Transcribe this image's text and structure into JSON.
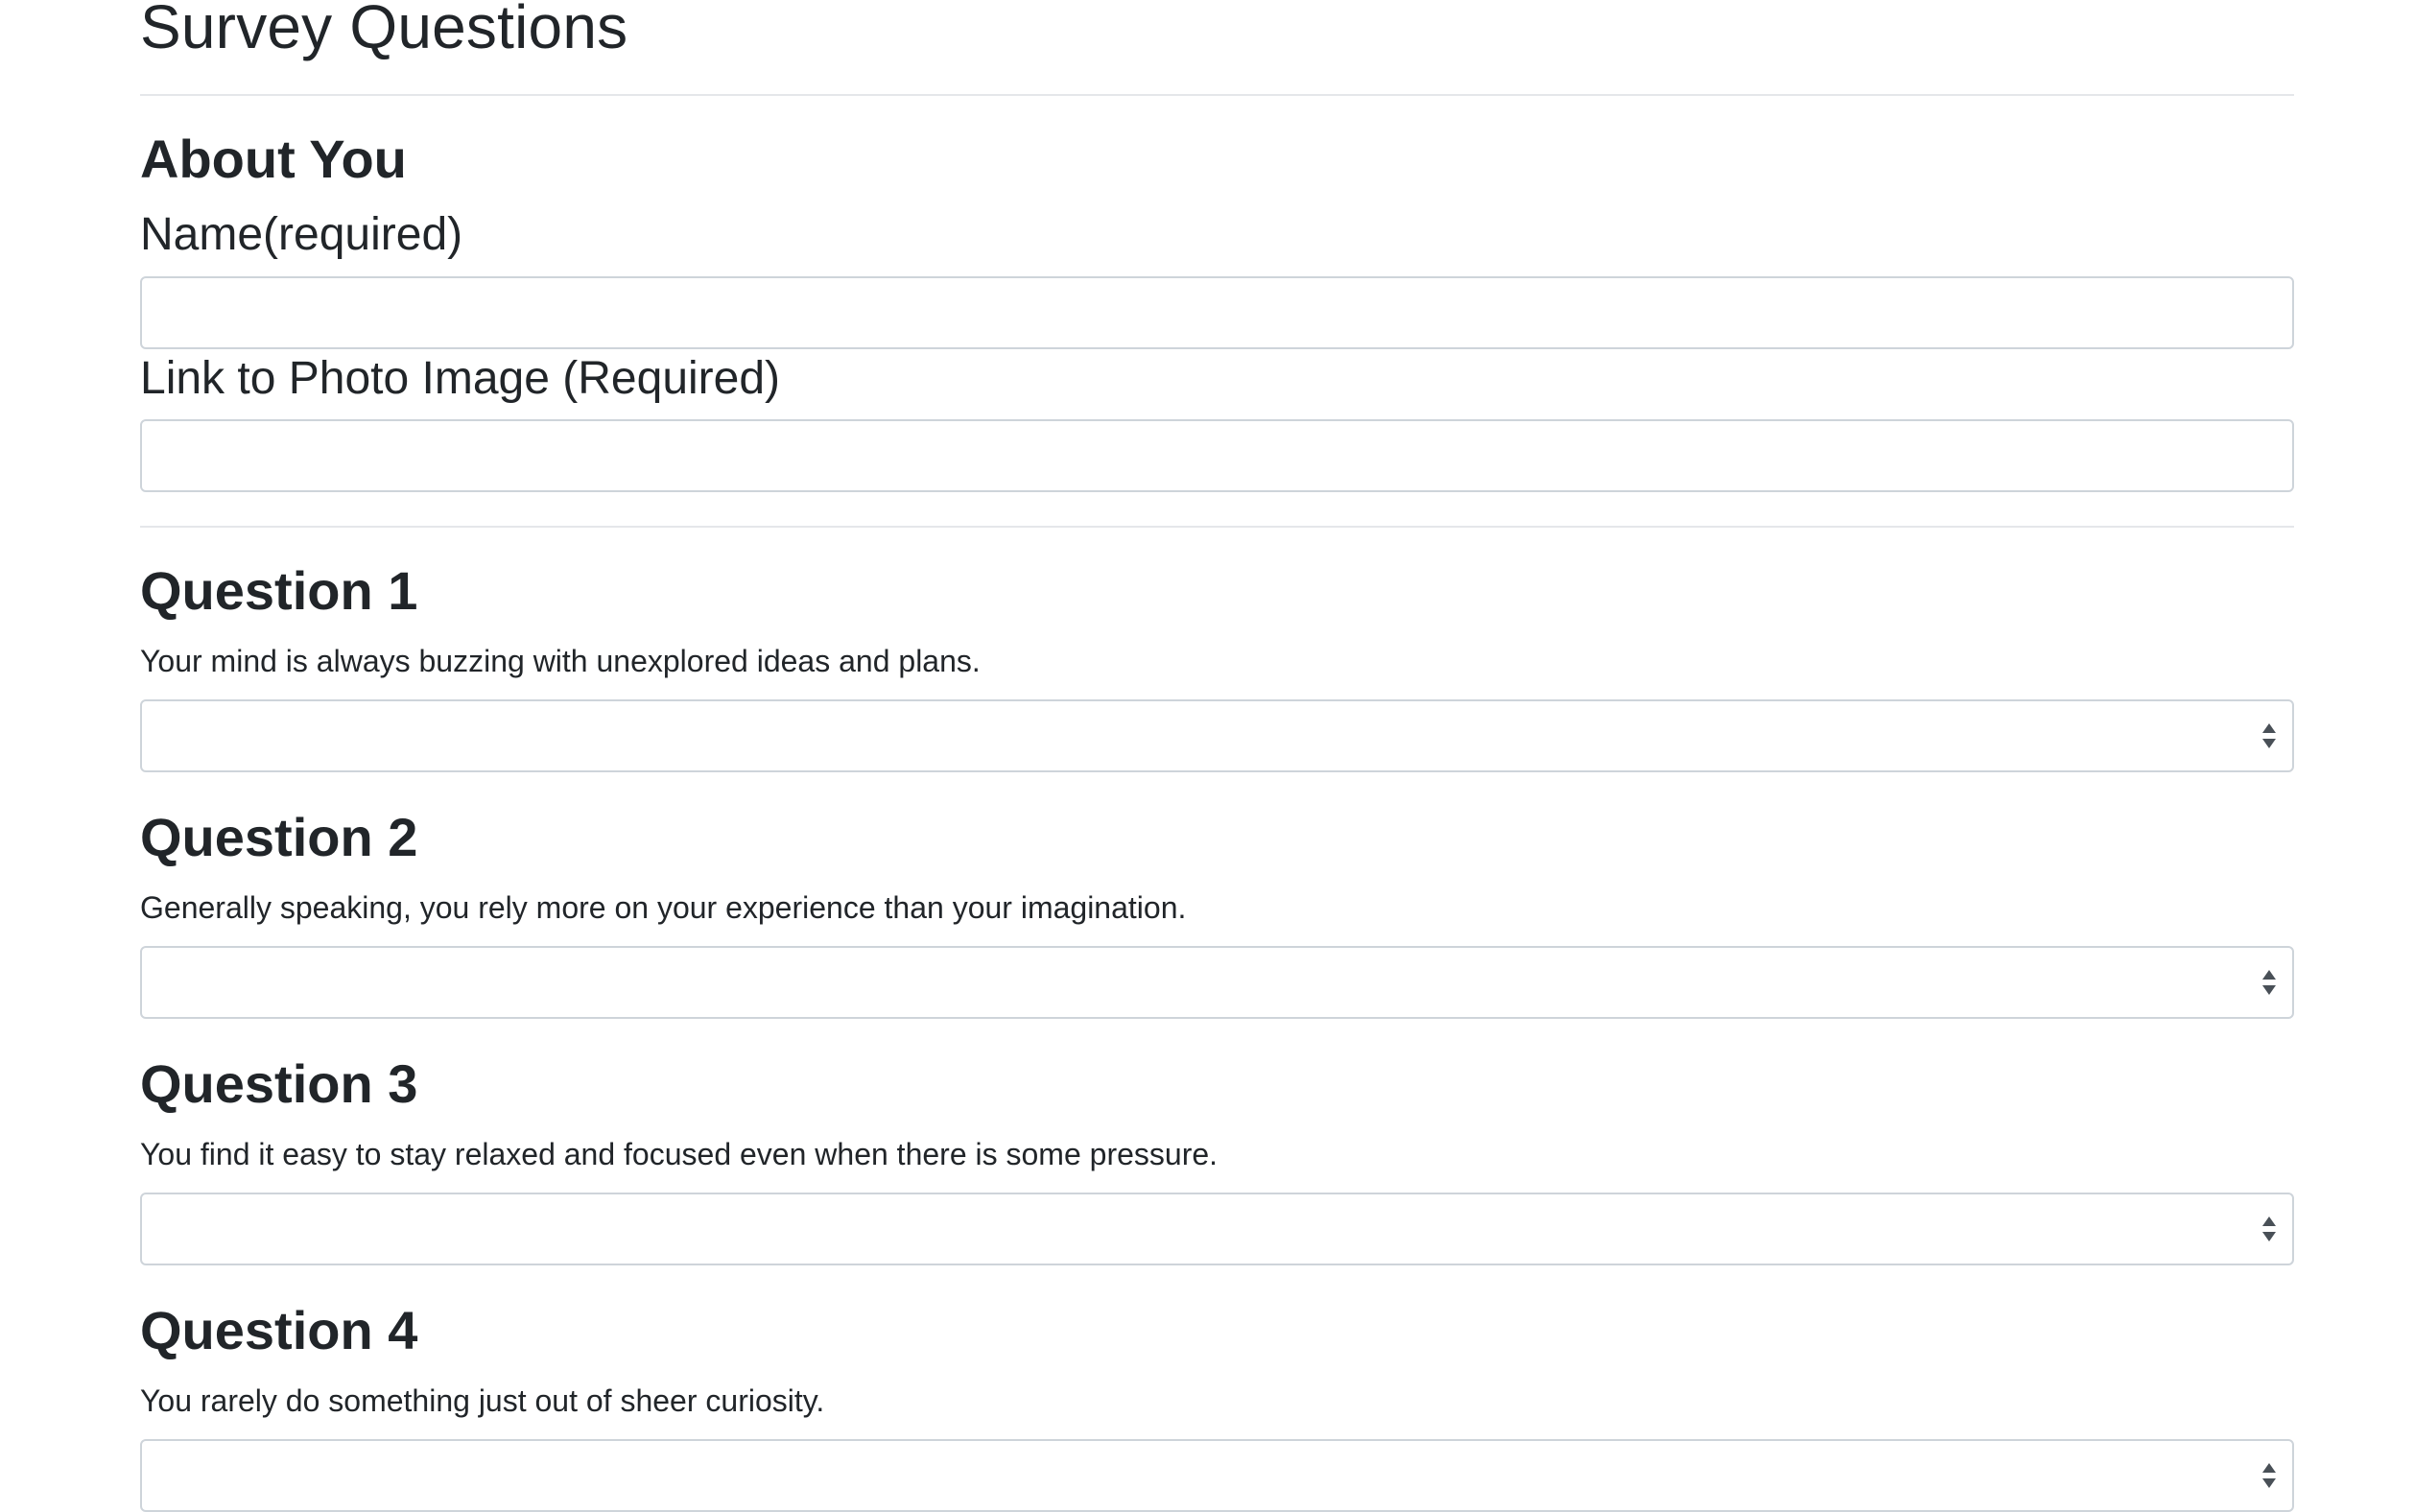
{
  "page": {
    "title": "Survey Questions"
  },
  "about": {
    "heading": "About You",
    "name_label": "Name(required)",
    "name_value": "",
    "photo_label": "Link to Photo Image (Required)",
    "photo_value": ""
  },
  "questions": [
    {
      "heading": "Question 1",
      "text": "Your mind is always buzzing with unexplored ideas and plans.",
      "selected": ""
    },
    {
      "heading": "Question 2",
      "text": "Generally speaking, you rely more on your experience than your imagination.",
      "selected": ""
    },
    {
      "heading": "Question 3",
      "text": "You find it easy to stay relaxed and focused even when there is some pressure.",
      "selected": ""
    },
    {
      "heading": "Question 4",
      "text": "You rarely do something just out of sheer curiosity.",
      "selected": ""
    }
  ],
  "colors": {
    "text": "#212529",
    "border": "#ced4da",
    "divider": "#e5e7ea",
    "arrow": "#495057"
  },
  "icons": {
    "select_arrows": "up-down-caret-icon"
  }
}
